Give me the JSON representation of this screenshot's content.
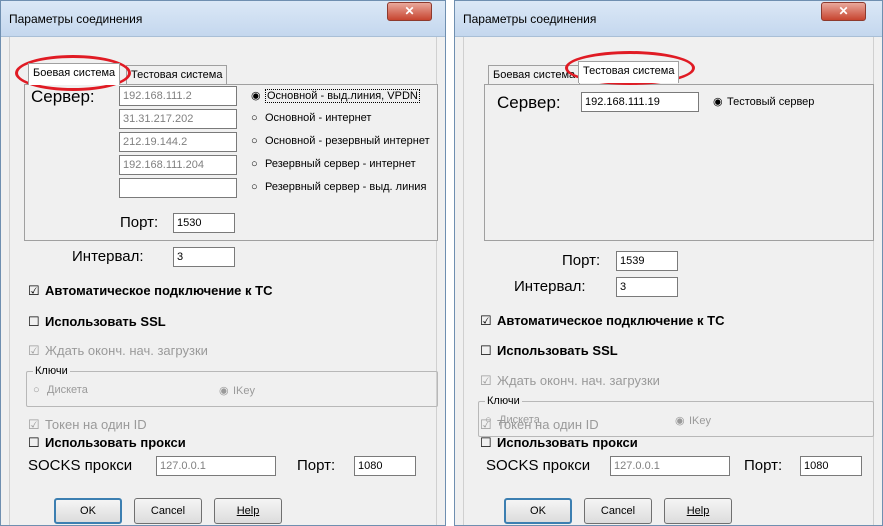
{
  "left": {
    "title": "Параметры соединения",
    "close_glyph": "✕",
    "tabs": [
      "Боевая система",
      "Тестовая система"
    ],
    "server_label": "Сервер:",
    "servers": [
      {
        "ip": "192.168.111.2",
        "option": "Основной - выд.линия, VPDN",
        "selected": true
      },
      {
        "ip": "31.31.217.202",
        "option": "Основной - интернет",
        "selected": false
      },
      {
        "ip": "212.19.144.2",
        "option": "Основной - резервный интернет",
        "selected": false
      },
      {
        "ip": "192.168.111.204",
        "option": "Резервный сервер - интернет",
        "selected": false
      },
      {
        "ip": "",
        "option": "Резервный сервер - выд. линия",
        "selected": false
      }
    ],
    "port_label": "Порт:",
    "port_value": "1530",
    "interval_label": "Интервал:",
    "interval_value": "3"
  },
  "right": {
    "title": "Параметры соединения",
    "close_glyph": "✕",
    "tabs": [
      "Боевая система",
      "Тестовая система"
    ],
    "server_label": "Сервер:",
    "server_ip": "192.168.111.19",
    "server_option": "Тестовый сервер",
    "port_label": "Порт:",
    "port_value": "1539",
    "interval_label": "Интервал:",
    "interval_value": "3"
  },
  "common": {
    "auto_connect": "Автоматическое подключение к ТС",
    "use_ssl": "Использовать SSL",
    "wait_load": "Ждать оконч. нач. загрузки",
    "keys_group": "Ключи",
    "key_diskette": "Дискета",
    "key_ikey": "IKey",
    "token": "Токен на один ID",
    "use_proxy": "Использовать прокси",
    "socks_label": "SOCKS прокси",
    "socks_value": "127.0.0.1",
    "proxy_port_label": "Порт:",
    "proxy_port_value": "1080",
    "ok": "OK",
    "cancel": "Cancel",
    "help": "Help",
    "checked_glyph": "☑",
    "unchecked_glyph": "☐",
    "radio_on": "◉",
    "radio_off": "○"
  },
  "colors": {
    "highlight": "#e01b24",
    "close": "#c7442f"
  }
}
